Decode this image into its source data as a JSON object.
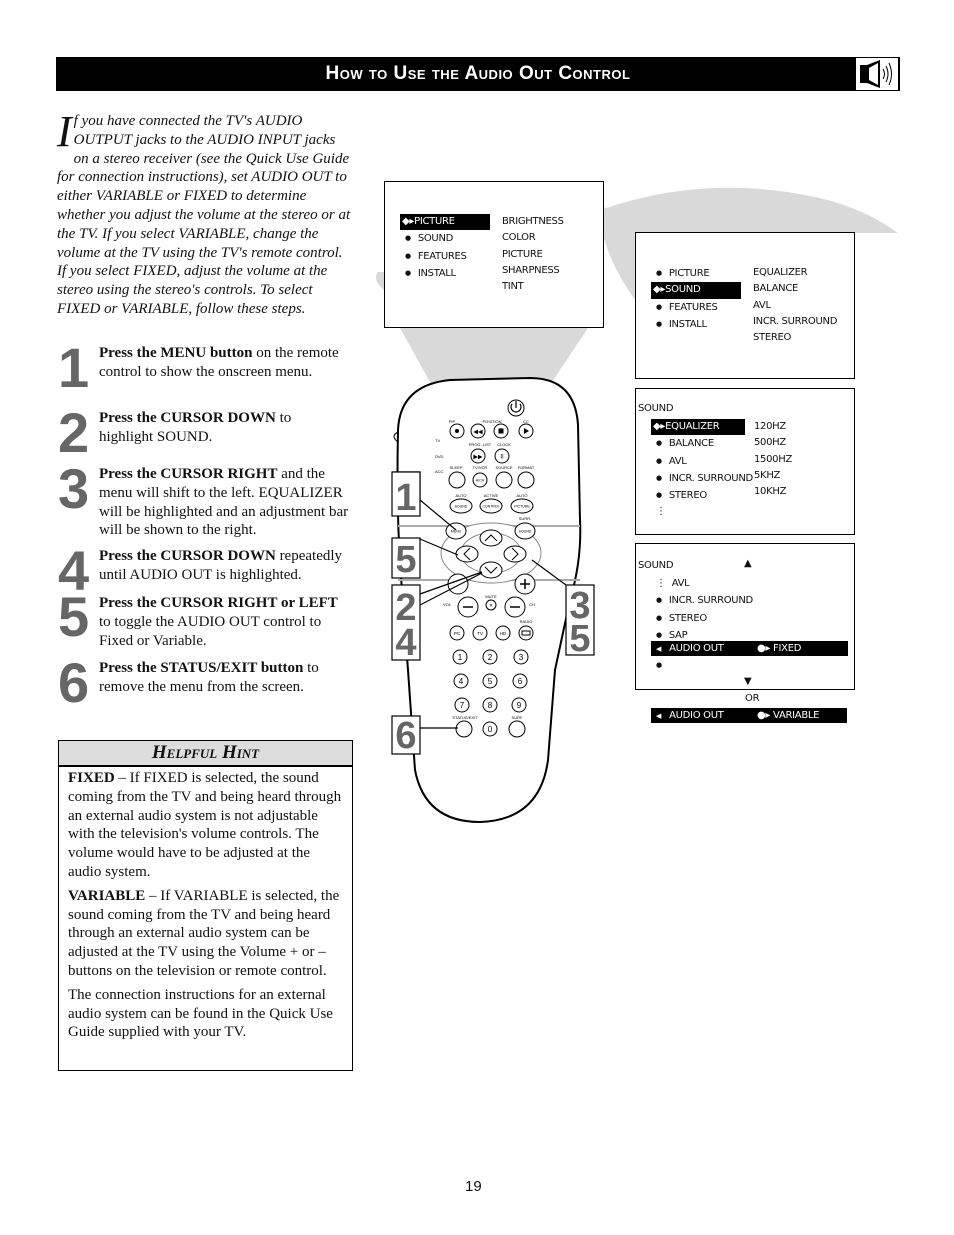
{
  "header": {
    "title": "How to Use the Audio Out Control",
    "icon": "speaker-icon"
  },
  "intro": {
    "dropcap": "I",
    "text": "f you have connected the TV's AUDIO OUTPUT jacks to the AUDIO INPUT jacks on a stereo receiver (see the Quick Use Guide for connection instructions), set AUDIO OUT to either VARIABLE or FIXED to determine whether you adjust the volume at the stereo or at the TV.  If you select VARIABLE, change the volume at the TV using the TV's remote control.  If you select FIXED, adjust the volume at the stereo using the stereo's controls. To select FIXED or VARIABLE, follow these steps."
  },
  "steps": [
    {
      "num": "1",
      "bold": "Press the MENU button",
      "rest": " on the remote control to show the onscreen menu."
    },
    {
      "num": "2",
      "bold": "Press the CURSOR DOWN",
      "rest": " to highlight SOUND."
    },
    {
      "num": "3",
      "bold": "Press the CURSOR RIGHT",
      "rest": " and the menu will shift to the left. EQUALIZER will be highlighted and an adjustment bar will be shown to the right."
    },
    {
      "num": "4",
      "bold": "Press the CURSOR DOWN",
      "rest": " repeatedly until AUDIO OUT is highlighted."
    },
    {
      "num": "5",
      "bold": "Press the CURSOR RIGHT or LEFT",
      "rest": " to toggle the AUDIO OUT control to Fixed or Variable."
    },
    {
      "num": "6",
      "bold": "Press the STATUS/EXIT button",
      "rest": " to remove the menu from the screen."
    }
  ],
  "hint": {
    "title": "Helpful Hint",
    "paragraphs": [
      {
        "bold": "FIXED",
        "rest": " – If FIXED is selected, the sound coming from the TV and being heard through an external audio system is not adjustable with the television's volume controls. The volume would have to be adjusted at the audio system."
      },
      {
        "bold": "VARIABLE",
        "rest": " – If VARIABLE is selected, the sound coming from the TV and being heard through an external audio system can be adjusted at the TV using the Volume + or – buttons on the television or remote control."
      },
      {
        "bold": "",
        "rest": "The connection instructions for an external audio system can be found in the Quick Use Guide supplied with your TV."
      }
    ]
  },
  "screen1": {
    "left": [
      "PICTURE",
      "SOUND",
      "FEATURES",
      "INSTALL"
    ],
    "highlighted": "PICTURE",
    "right": [
      "BRIGHTNESS",
      "COLOR",
      "PICTURE",
      "SHARPNESS",
      "TINT"
    ]
  },
  "screen2": {
    "left": [
      "PICTURE",
      "SOUND",
      "FEATURES",
      "INSTALL"
    ],
    "highlighted": "SOUND",
    "right": [
      "EQUALIZER",
      "BALANCE",
      "AVL",
      "INCR. SURROUND",
      "STEREO"
    ]
  },
  "screen3": {
    "title": "SOUND",
    "left": [
      "EQUALIZER",
      "BALANCE",
      "AVL",
      "INCR. SURROUND",
      "STEREO"
    ],
    "highlighted": "EQUALIZER",
    "right": [
      "120HZ",
      "500HZ",
      "1500HZ",
      "5KHZ",
      "10KHZ"
    ]
  },
  "screen4": {
    "title": "SOUND",
    "items": [
      "AVL",
      "INCR. SURROUND",
      "STEREO",
      "SAP"
    ],
    "selected_label": "AUDIO OUT",
    "selected_value": "FIXED",
    "or_label": "OR",
    "alt_label": "AUDIO OUT",
    "alt_value": "VARIABLE"
  },
  "remote": {
    "labels": {
      "pip": "PIP",
      "position": "POSITION",
      "cc": "CC",
      "prog_list": "PROG. LIST",
      "clock": "CLOCK",
      "tv": "TV",
      "dvd": "DVD",
      "acc": "ACC",
      "sleep": "SLEEP",
      "tvvcr": "TV/VCR",
      "source": "SOURCE",
      "format": "FORMAT",
      "avch": "A/CH",
      "auto1": "AUTO",
      "active": "ACTIVE",
      "auto2": "AUTO",
      "sound": "SOUND",
      "control": "CONTROL",
      "picture": "PICTURE",
      "menu": "MENU",
      "surr": "SURR.",
      "surr_sound": "SOUND",
      "vol": "VOL",
      "mute": "MUTE",
      "ch": "CH",
      "pc": "PC",
      "tv2": "TV",
      "hd": "HD",
      "radio": "RADIO",
      "status_exit": "STATUS/EXIT",
      "surf": "SURF"
    },
    "digits": [
      "1",
      "2",
      "3",
      "4",
      "5",
      "6",
      "7",
      "8",
      "9",
      "0"
    ],
    "callouts": [
      "1",
      "5",
      "2",
      "4",
      "3",
      "5",
      "6"
    ]
  },
  "page_number": "19"
}
